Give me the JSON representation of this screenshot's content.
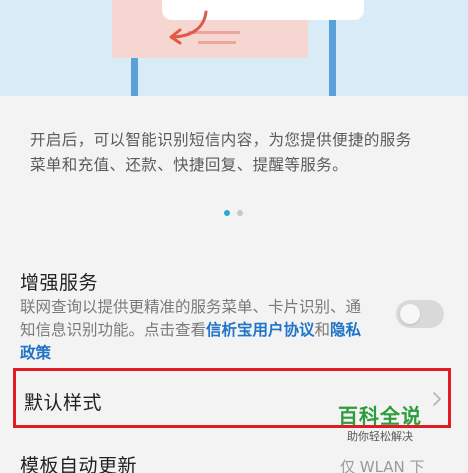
{
  "description": {
    "line1": "开启后，可以智能识别短信内容，为您提供便捷的服务",
    "line2": "菜单和充值、还款、快捷回复、提醒等服务。"
  },
  "pager": {
    "current": 1,
    "total": 2
  },
  "enhanced_service": {
    "title": "增强服务",
    "desc_part1": "联网查询以提供更精准的服务菜单、卡片识别、通知信息识别功能。点击查看",
    "link_user_agreement": "信析宝用户协议",
    "desc_and": "和",
    "link_privacy": "隐私政策",
    "enabled": false
  },
  "default_style": {
    "label": "默认样式"
  },
  "template_update": {
    "label": "模板自动更新",
    "value": "仅 WLAN 下"
  },
  "watermark": {
    "main": "百科全说",
    "sub": "助你轻松解决"
  },
  "colors": {
    "accent": "#2aa7d9",
    "link": "#1f74c8",
    "highlight_border": "#e01b24",
    "watermark_green": "#2c9c3c"
  }
}
